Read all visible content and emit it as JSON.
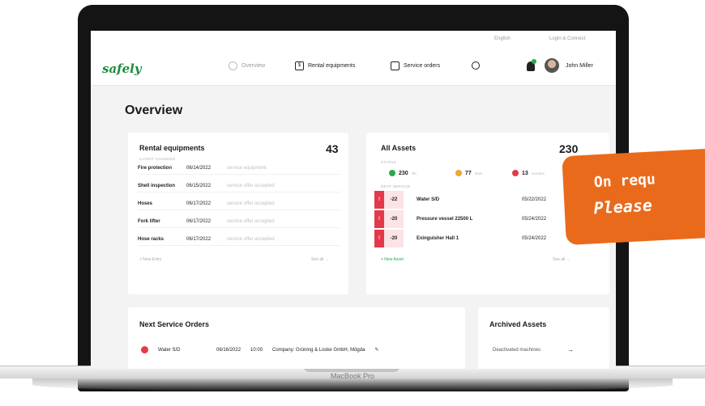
{
  "util": {
    "language": "English",
    "login": "Login & Connect"
  },
  "nav": {
    "logo": "safely",
    "items": [
      {
        "label": "Overview",
        "icon": "overview-icon",
        "active": true
      },
      {
        "label": "Rental equipments",
        "icon": "equipment-icon",
        "active": false
      },
      {
        "label": "Service orders",
        "icon": "orders-icon",
        "active": false
      }
    ],
    "user_name": "John Miller"
  },
  "page_title": "Overview",
  "rental": {
    "title": "Rental equipments",
    "count": "43",
    "caption": "LATEST CHANGES",
    "rows": [
      {
        "name": "Fire protection",
        "date": "06/14/2022",
        "status": "service equipment"
      },
      {
        "name": "Shell inspection",
        "date": "06/15/2022",
        "status": "service offer accepted"
      },
      {
        "name": "Hoses",
        "date": "06/17/2022",
        "status": "service offer accepted"
      },
      {
        "name": "Fork lifter",
        "date": "06/17/2022",
        "status": "service offer accepted"
      },
      {
        "name": "Hose racks",
        "date": "06/17/2022",
        "status": "service offer accepted"
      }
    ],
    "footer_left": "+ New Entry",
    "footer_right": "See all →"
  },
  "assets": {
    "title": "All Assets",
    "count": "230",
    "caption": "STATUS",
    "stats": [
      {
        "value": "230",
        "label": "OK",
        "color": "#2aa84a"
      },
      {
        "value": "77",
        "label": "DUE",
        "color": "#f0a630"
      },
      {
        "value": "13",
        "label": "overdue",
        "color": "#e23a4a"
      }
    ],
    "caption2": "NEXT SERVICE",
    "rows": [
      {
        "days": "-22",
        "name": "Water S/D",
        "date": "05/22/2022"
      },
      {
        "days": "-20",
        "name": "Pressure vessel 22500 L",
        "date": "05/24/2022"
      },
      {
        "days": "-20",
        "name": "Exinguisher Hall 1",
        "date": "05/24/2022"
      }
    ],
    "footer_left": "+ New Asset",
    "footer_right": "See all →"
  },
  "service_orders": {
    "title": "Next Service Orders",
    "row": {
      "name": "Water S/D",
      "date": "06/16/2022",
      "time": "10:00",
      "company": "Company: Grüning & Loske GmbH, Mögda"
    }
  },
  "archived": {
    "title": "Archived Assets",
    "link": "Deactivated machines"
  },
  "device_label": "MacBook Pro",
  "promo": {
    "line1": "On requ",
    "line2": "Please"
  }
}
